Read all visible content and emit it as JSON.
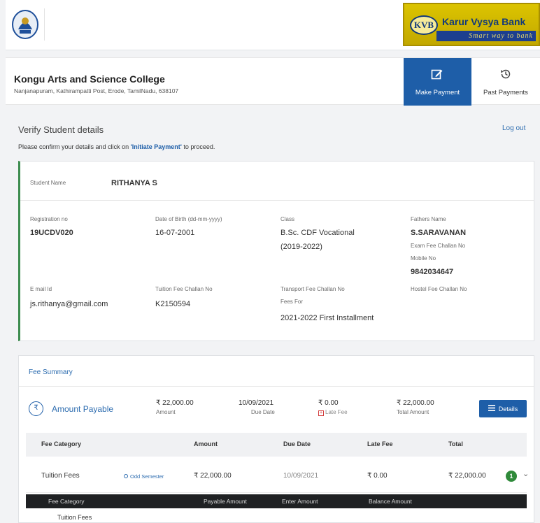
{
  "header": {
    "bank_name": "Karur Vysya Bank",
    "bank_abbr": "KVB",
    "bank_tagline": "Smart way to bank",
    "emblem_icon": "college-emblem-icon"
  },
  "college": {
    "name": "Kongu Arts and Science College",
    "address": "Nanjanapuram, Kathirampatti Post, Erode, TamilNadu, 638107"
  },
  "nav": {
    "make_payment": "Make Payment",
    "past_payments": "Past Payments"
  },
  "verify": {
    "title": "Verify Student details",
    "subtitle_pre": "Please confirm your details and click on ",
    "subtitle_link": "'Initiate Payment'",
    "subtitle_post": " to proceed.",
    "logout": "Log out"
  },
  "student": {
    "name_label": "Student Name",
    "name": "RITHANYA S",
    "reg_label": "Registration no",
    "reg": "19UCDV020",
    "dob_label": "Date of Birth (dd-mm-yyyy)",
    "dob": "16-07-2001",
    "class_label": "Class",
    "class_line1": "B.Sc. CDF Vocational",
    "class_line2": "(2019-2022)",
    "father_label": "Fathers Name",
    "father": "S.SARAVANAN",
    "exam_challan_label": "Exam Fee Challan No",
    "mobile_label": "Mobile No",
    "mobile": "9842034647",
    "email_label": "E mail Id",
    "email": "js.rithanya@gmail.com",
    "tuition_challan_label": "Tuition Fee Challan No",
    "tuition_challan": "K2150594",
    "transport_challan_label": "Transport Fee Challan No",
    "fees_for_label": "Fees For",
    "fees_for": "2021-2022 First Installment",
    "hostel_challan_label": "Hostel Fee Challan No"
  },
  "fee_summary": {
    "title": "Fee Summary",
    "rupee_symbol": "₹",
    "amount_payable_label": "Amount Payable",
    "amount": "₹ 22,000.00",
    "amount_label": "Amount",
    "due_date": "10/09/2021",
    "due_date_label": "Due Date",
    "late_fee": "₹ 0.00",
    "late_fee_label": "Late Fee",
    "total": "₹ 22,000.00",
    "total_label": "Total Amount",
    "details_button": "Details",
    "table_headers": [
      "Fee Category",
      "Amount",
      "Due Date",
      "Late Fee",
      "Total"
    ],
    "row": {
      "category": "Tuition Fees",
      "semester": "Odd Semester",
      "amount": "₹ 22,000.00",
      "due_date": "10/09/2021",
      "late_fee": "₹ 0.00",
      "total": "₹ 22,000.00",
      "badge": "1"
    },
    "sub_headers": [
      "Fee Category",
      "Payable Amount",
      "Enter Amount",
      "Balance Amount"
    ],
    "sub_row_partial": "Tuition Fees"
  },
  "colors": {
    "primary": "#1e5ea8",
    "link": "#2e6db0",
    "accent_green": "#3c8c4e",
    "late_fee_red": "#d23a3a",
    "bank_gold": "#d4bb00"
  }
}
